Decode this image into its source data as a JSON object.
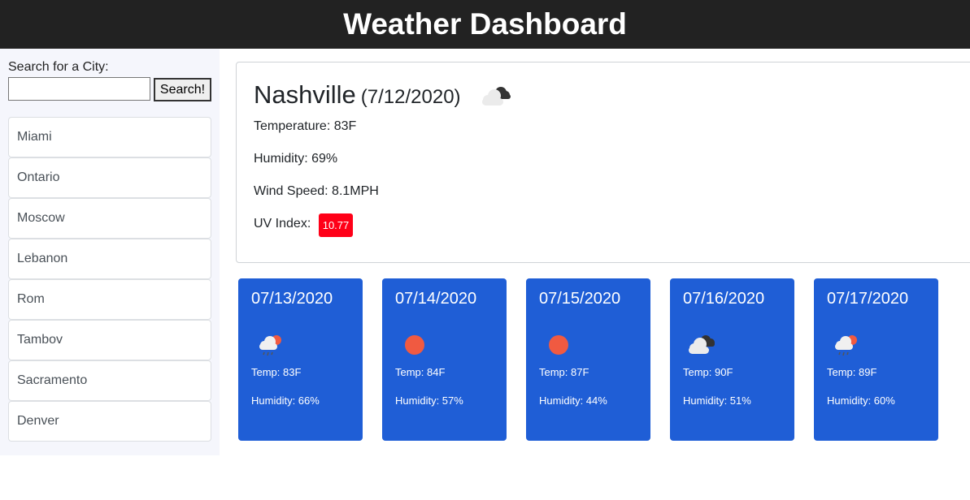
{
  "header": {
    "title": "Weather Dashboard"
  },
  "sidebar": {
    "search_label": "Search for a City:",
    "search_value": "",
    "search_button": "Search!",
    "cities": [
      "Miami",
      "Ontario",
      "Moscow",
      "Lebanon",
      "Rom",
      "Tambov",
      "Sacramento",
      "Denver"
    ]
  },
  "current": {
    "city": "Nashville",
    "date": "(7/12/2020)",
    "icon": "cloudy-icon",
    "temperature": "Temperature: 83F",
    "humidity": "Humidity: 69%",
    "wind": "Wind Speed: 8.1MPH",
    "uv_label": "UV Index:",
    "uv_value": "10.77",
    "uv_color": "#ff0018"
  },
  "forecast": [
    {
      "date": "07/13/2020",
      "icon": "rain-icon",
      "temp": "Temp: 83F",
      "humidity": "Humidity: 66%"
    },
    {
      "date": "07/14/2020",
      "icon": "sun-icon",
      "temp": "Temp: 84F",
      "humidity": "Humidity: 57%"
    },
    {
      "date": "07/15/2020",
      "icon": "sun-icon",
      "temp": "Temp: 87F",
      "humidity": "Humidity: 44%"
    },
    {
      "date": "07/16/2020",
      "icon": "cloudy-icon",
      "temp": "Temp: 90F",
      "humidity": "Humidity: 51%"
    },
    {
      "date": "07/17/2020",
      "icon": "rain-icon",
      "temp": "Temp: 89F",
      "humidity": "Humidity: 60%"
    }
  ],
  "colors": {
    "header_bg": "#222222",
    "card_bg": "#1f5ed6",
    "sun": "#f05a41"
  }
}
